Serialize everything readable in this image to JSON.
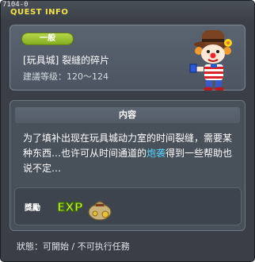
{
  "window": {
    "id": "7104-0",
    "title": "QUEST INFO"
  },
  "quest": {
    "category": "一般",
    "name": "[玩具城] 裂縫的碎片",
    "level_requirement": "建議等级：120～124",
    "npc_icon": "clown-npc-icon"
  },
  "content": {
    "header": "内容",
    "text_before": "为了填补出现在玩具城动力室的时间裂缝，需要某种东西…也许可从时间通道的",
    "text_highlight": "炮袭",
    "text_after": "得到一些帮助也说不定…"
  },
  "reward": {
    "label": "獎勵",
    "exp_label": "EXP",
    "items": [
      "exp-icon",
      "money-bag-icon"
    ]
  },
  "status": {
    "text": "狀態：可開始 / 不可执行任務"
  },
  "colors": {
    "title": "#f2e24a",
    "badge": "#9cc236",
    "highlight": "#5ad6ff",
    "window_bg": "#3a3f47"
  }
}
